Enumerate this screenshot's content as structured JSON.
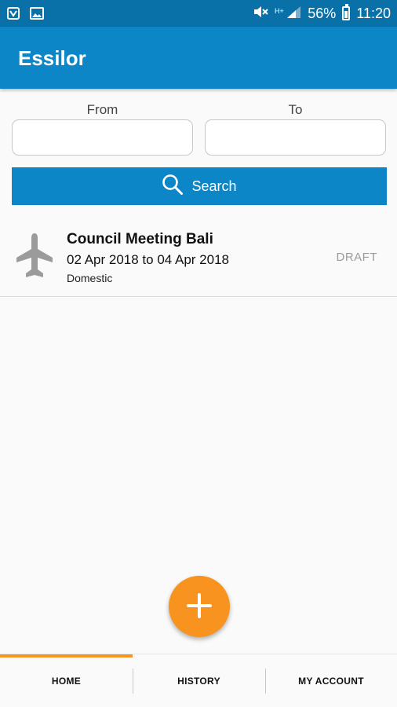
{
  "colors": {
    "status_bar": "#0a71a8",
    "app_bar": "#0d86c8",
    "accent": "#f7931e",
    "draft_text": "#9a9a9a"
  },
  "status_bar": {
    "battery": "56%",
    "time": "11:20",
    "icons": [
      "gallery-icon",
      "image-icon",
      "mute-icon",
      "signal-icon",
      "battery-icon"
    ]
  },
  "app_bar": {
    "title": "Essilor"
  },
  "search": {
    "from_label": "From",
    "to_label": "To",
    "from_value": "",
    "to_value": "",
    "button_label": "Search"
  },
  "trips": [
    {
      "icon": "plane-icon",
      "title": "Council Meeting Bali",
      "dates": "02 Apr 2018 to 04 Apr 2018",
      "type": "Domestic",
      "status": "DRAFT"
    }
  ],
  "fab": {
    "icon": "plus-icon"
  },
  "bottom_nav": {
    "tabs": [
      {
        "label": "HOME",
        "active": true
      },
      {
        "label": "HISTORY",
        "active": false
      },
      {
        "label": "MY ACCOUNT",
        "active": false
      }
    ]
  }
}
